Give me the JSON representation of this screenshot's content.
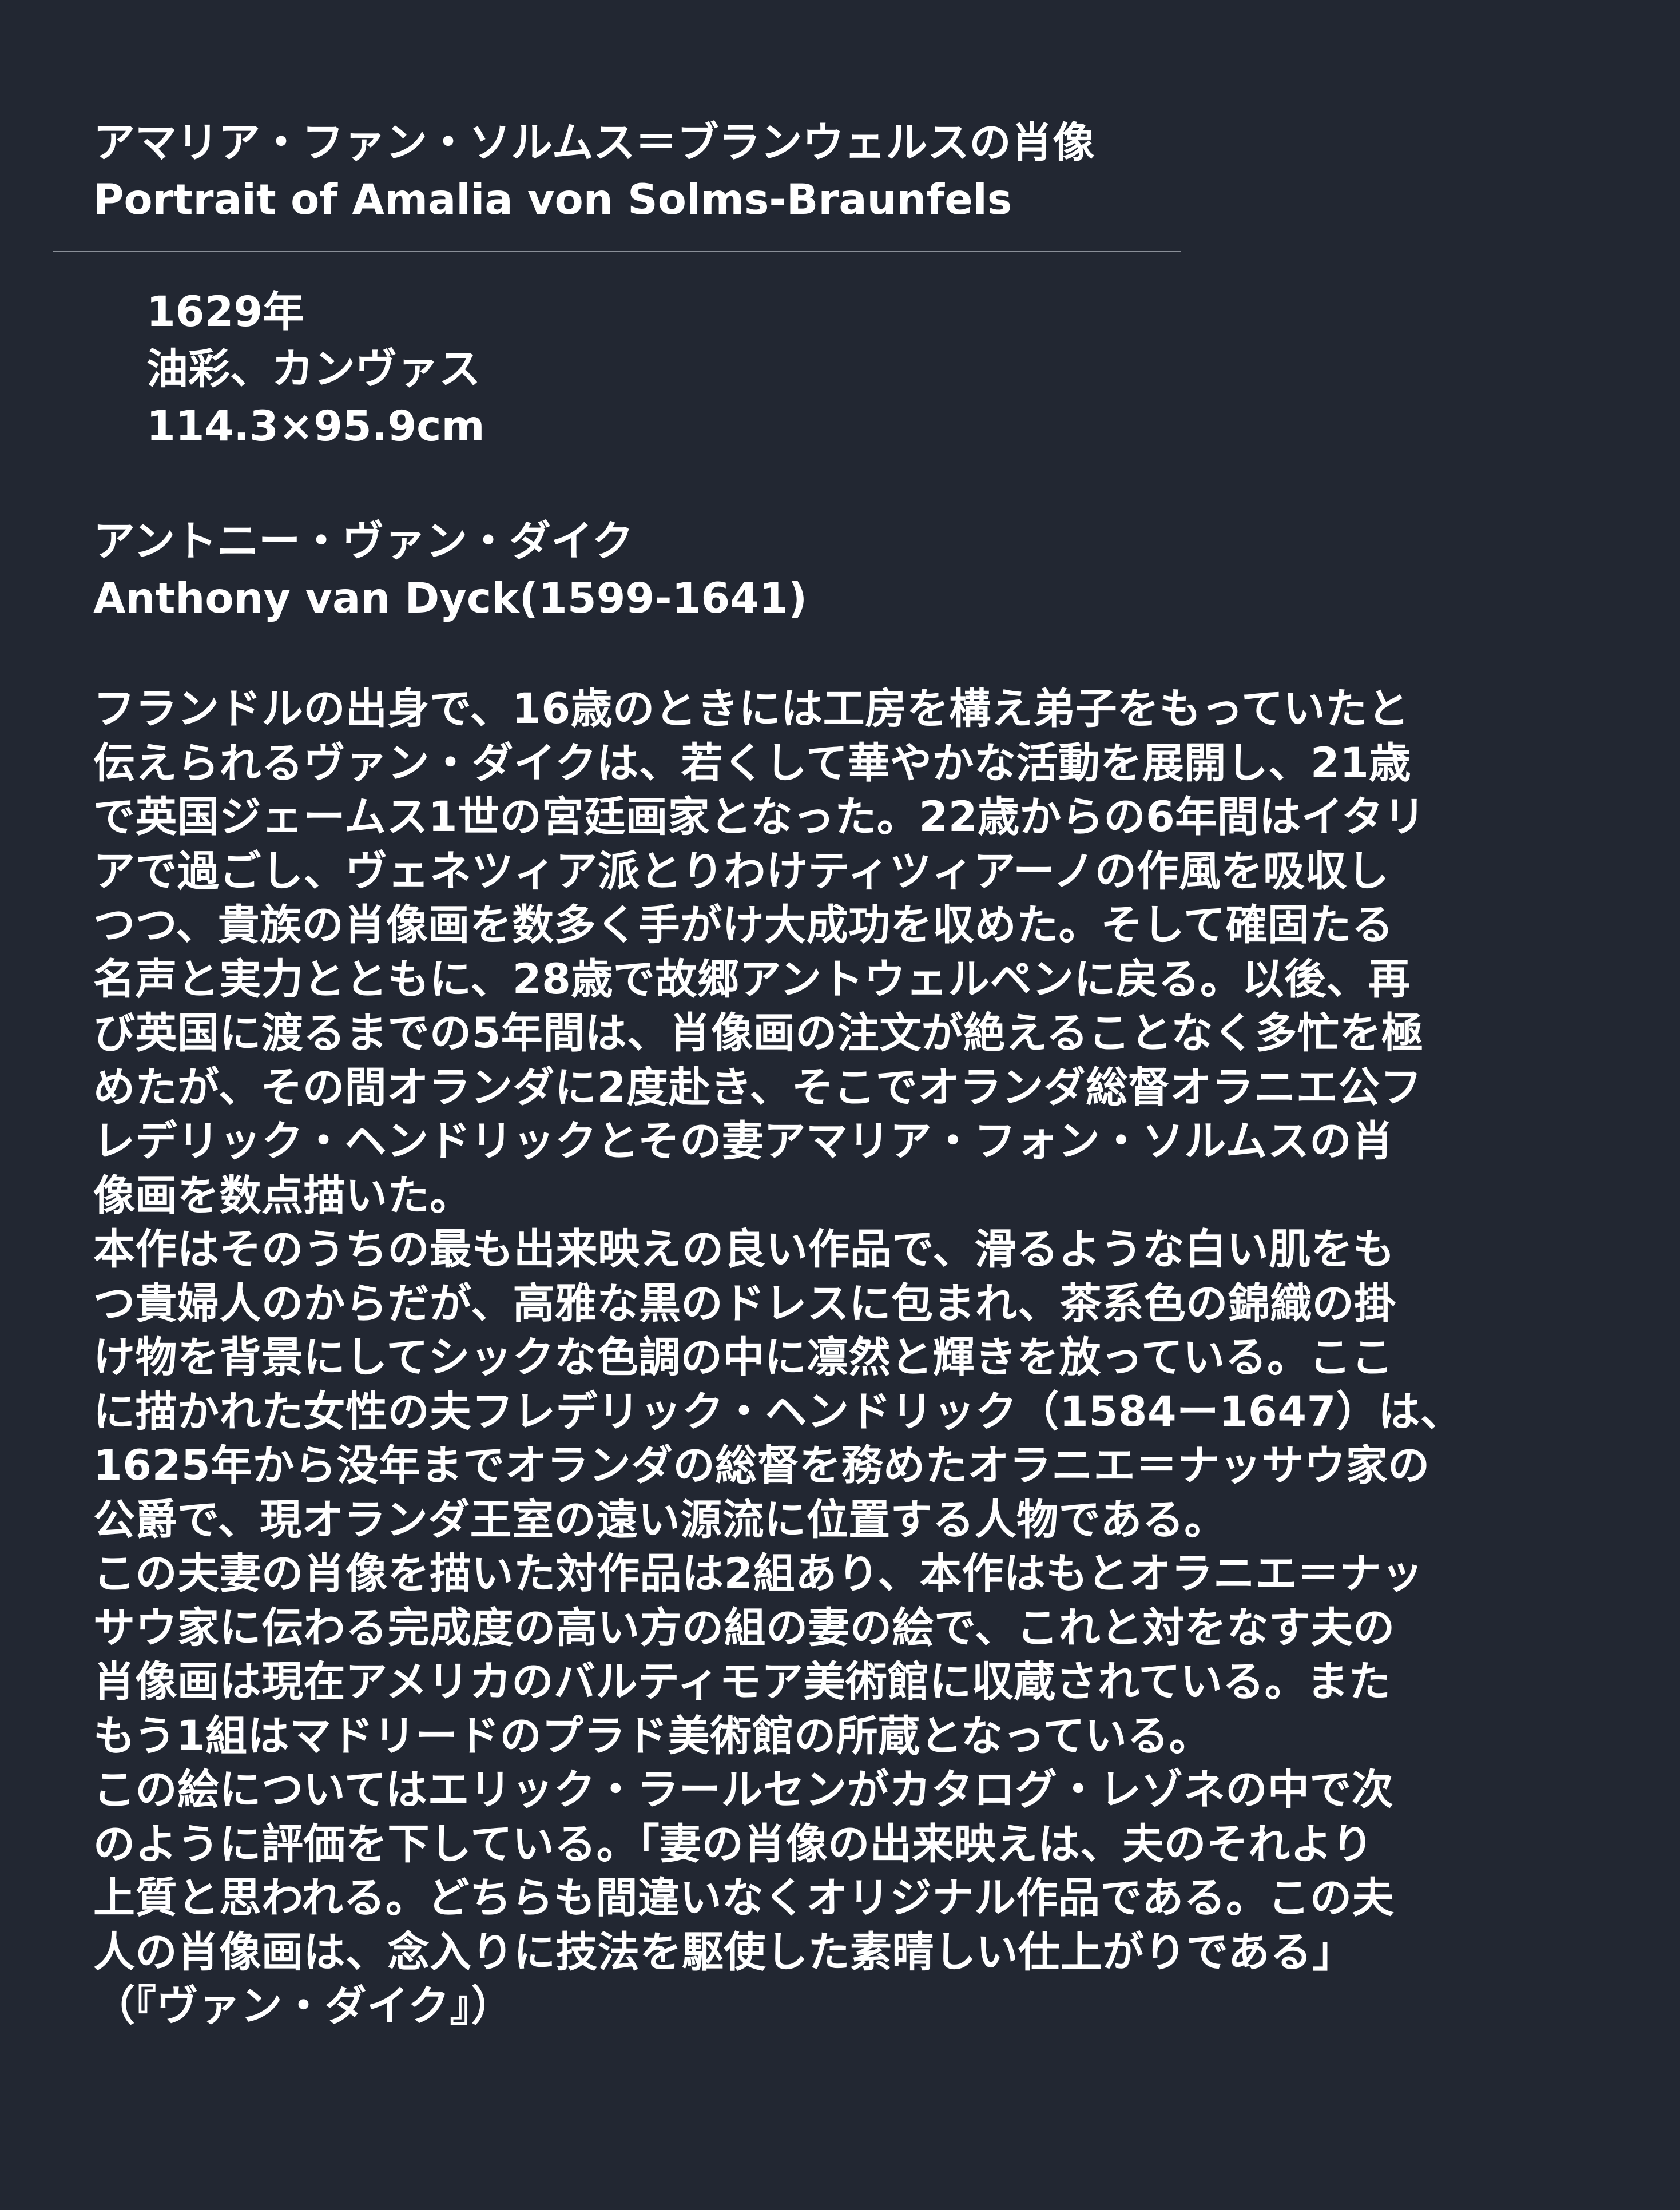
{
  "title": {
    "japanese": "アマリア・ファン・ソルムス＝ブランウェルスの肖像",
    "english": "Portrait of Amalia von Solms-Braunfels"
  },
  "details": {
    "year": "1629年",
    "medium": "油彩、カンヴァス",
    "dimensions": "114.3×95.9cm"
  },
  "artist": {
    "japanese": "アントニー・ヴァン・ダイク",
    "english": "Anthony van Dyck(1599-1641)"
  },
  "description_lines": [
    "フランドルの出身で、16歳のときには工房を構え弟子をもっていたと",
    "伝えられるヴァン・ダイクは、若くして華やかな活動を展開し、21歳",
    "で英国ジェームス1世の宮廷画家となった。22歳からの6年間はイタリ",
    "アで過ごし、ヴェネツィア派とりわけティツィアーノの作風を吸収し",
    "つつ、貴族の肖像画を数多く手がけ大成功を収めた。そして確固たる",
    "名声と実力とともに、28歳で故郷アントウェルペンに戻る。以後、再",
    "び英国に渡るまでの5年間は、肖像画の注文が絶えることなく多忙を極",
    "めたが、その間オランダに2度赴き、そこでオランダ総督オラニエ公フ",
    "レデリック・ヘンドリックとその妻アマリア・フォン・ソルムスの肖",
    "像画を数点描いた。",
    "本作はそのうちの最も出来映えの良い作品で、滑るような白い肌をも",
    "つ貴婦人のからだが、高雅な黒のドレスに包まれ、茶系色の錦織の掛",
    "け物を背景にしてシックな色調の中に凛然と輝きを放っている。ここ",
    "に描かれた女性の夫フレデリック・ヘンドリック（1584ー1647）は、",
    "1625年から没年までオランダの総督を務めたオラニエ＝ナッサウ家の",
    "公爵で、現オランダ王室の遠い源流に位置する人物である。",
    "この夫妻の肖像を描いた対作品は2組あり、本作はもとオラニエ＝ナッ",
    "サウ家に伝わる完成度の高い方の組の妻の絵で、これと対をなす夫の",
    "肖像画は現在アメリカのバルティモア美術館に収蔵されている。また",
    "もう1組はマドリードのプラド美術館の所蔵となっている。",
    "この絵についてはエリック・ラールセンがカタログ・レゾネの中で次",
    "のように評価を下している。「妻の肖像の出来映えは、夫のそれより",
    "上質と思われる。どちらも間違いなくオリジナル作品である。この夫",
    "人の肖像画は、念入りに技法を駆使した素晴しい仕上がりである」",
    "（『ヴァン・ダイク』）"
  ]
}
